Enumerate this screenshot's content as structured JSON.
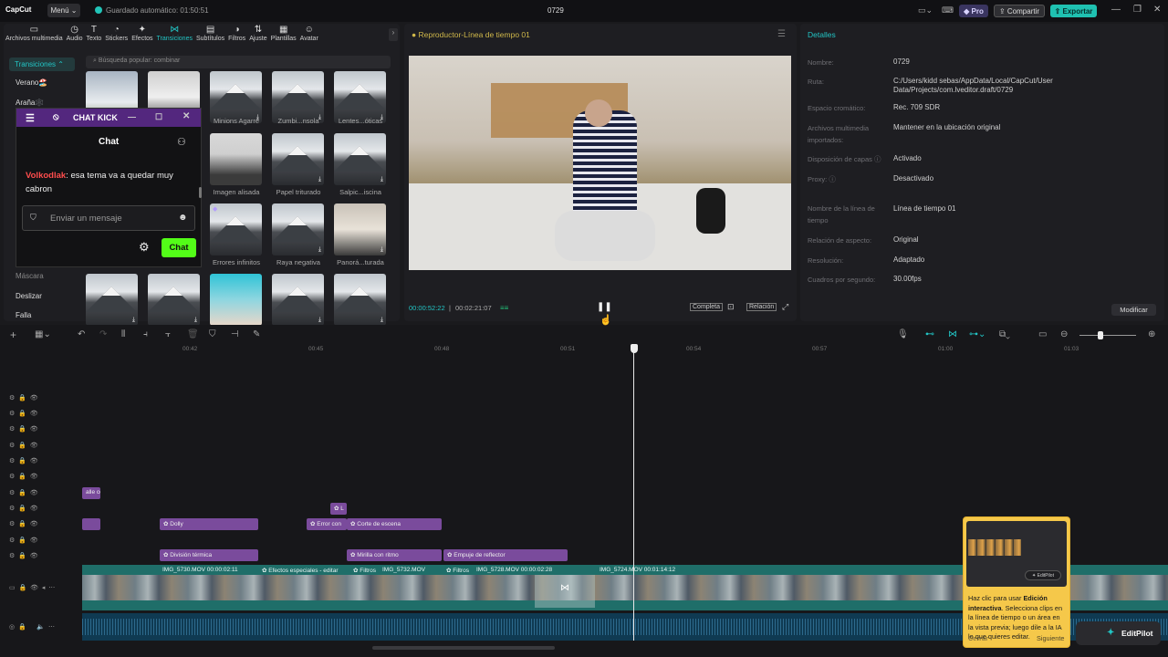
{
  "app": {
    "logo": "CapCut",
    "menu": "Menú",
    "autosave": "Guardado automático: 01:50:51",
    "project_title": "0729",
    "pro": "Pro",
    "share": "Compartir",
    "export": "Exportar"
  },
  "media_tabs": [
    {
      "label": "Archivos multimedia",
      "icon": "▭"
    },
    {
      "label": "Audio",
      "icon": "◷"
    },
    {
      "label": "Texto",
      "icon": "T"
    },
    {
      "label": "Stickers",
      "icon": "◔"
    },
    {
      "label": "Efectos",
      "icon": "✦"
    },
    {
      "label": "Transiciones",
      "icon": "⋈"
    },
    {
      "label": "Subtítulos",
      "icon": "▤"
    },
    {
      "label": "Filtros",
      "icon": "◑"
    },
    {
      "label": "Ajuste",
      "icon": "⇅"
    },
    {
      "label": "Plantillas",
      "icon": "▦"
    },
    {
      "label": "Avatar",
      "icon": "☺"
    }
  ],
  "transitions_sidebar": {
    "active": "Transiciones",
    "items": [
      "Verano🏖️",
      "Araña🕸️",
      "Máscara",
      "Deslizar",
      "Falla"
    ]
  },
  "search_placeholder": "Búsqueda popular: combinar",
  "tiles": [
    {
      "caption": "Minions Agarre"
    },
    {
      "caption": "Zumbi...nsola"
    },
    {
      "caption": "Lentes...óticas"
    },
    {
      "caption": "Imagen alisada"
    },
    {
      "caption": "Papel triturado"
    },
    {
      "caption": "Salpic...iscina"
    },
    {
      "caption": "Errores infinitos"
    },
    {
      "caption": "Raya negativa"
    },
    {
      "caption": "Panorá...turada"
    }
  ],
  "chat": {
    "window_title": "CHAT KICK",
    "header": "Chat",
    "message_user": "Volkodlak",
    "message_text": ": esa tema va a quedar muy cabron",
    "input_placeholder": "Enviar un mensaje",
    "send_label": "Chat"
  },
  "player": {
    "title": "Reproductor-Línea de tiempo 01",
    "current_time": "00:00:52:22",
    "total_time": "00:02:21:07",
    "btn_full": "Completa",
    "btn_ratio": "Relación"
  },
  "details": {
    "title": "Detalles",
    "rows": [
      {
        "label": "Nombre:",
        "value": "0729"
      },
      {
        "label": "Ruta:",
        "value": "C:/Users/kidd sebas/AppData/Local/CapCut/User Data/Projects/com.lveditor.draft/0729"
      },
      {
        "label": "Espacio cromático:",
        "value": "Rec. 709 SDR"
      },
      {
        "label": "Archivos multimedia importados:",
        "value": "Mantener en la ubicación original"
      },
      {
        "label": "Disposición de capas ⓘ",
        "value": "Activado"
      },
      {
        "label": "Proxy: ⓘ",
        "value": "Desactivado"
      },
      {
        "label": "Nombre de la línea de tiempo",
        "value": "Línea de tiempo 01"
      },
      {
        "label": "Relación de aspecto:",
        "value": "Original"
      },
      {
        "label": "Resolución:",
        "value": "Adaptado"
      },
      {
        "label": "Cuadros por segundo:",
        "value": "30.00fps"
      }
    ],
    "modify": "Modificar"
  },
  "ruler_ticks": [
    "00:42",
    "00:45",
    "00:48",
    "00:51",
    "00:54",
    "00:57",
    "01:00",
    "01:03"
  ],
  "clips": {
    "lane_a": "alle co",
    "dolly": "Dolly",
    "error": "Error con",
    "corte": "Corte de escena",
    "division": "División térmica",
    "mirilla": "Mirilla con ritmo",
    "empuje": "Empuje de reflector",
    "img1": "IMG_5730.MOV   00:00:02:11",
    "efectos": "Efectos especiales - editar",
    "filtros1": "Filtros",
    "img2": "IMG_5732.MOV",
    "filtros2": "Filtros",
    "img3": "IMG_5728.MOV   00:00:02:28",
    "img4": "IMG_5724.MOV   00:01:14:12"
  },
  "editpilot": {
    "card_text_1": "Haz clic para usar ",
    "card_bold": "Edición interactiva",
    "card_text_2": ". Selecciona clips en la línea de tiempo o un área en la vista previa; luego dile a la IA lo que quieres editar.",
    "close": "Cerrar",
    "next": "Siguiente",
    "button": "EditPilot"
  },
  "colors": {
    "accent": "#22c4c4",
    "clip": "#7a4b9c",
    "main_track": "#1f6e69",
    "chat_header": "#53277e",
    "card": "#f5c84a"
  }
}
